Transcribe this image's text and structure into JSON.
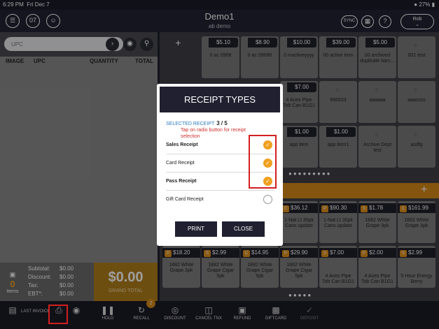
{
  "status": {
    "time": "6:29 PM",
    "date": "Fri Dec 7",
    "battery": "27%"
  },
  "header": {
    "title": "Demo1",
    "subtitle": "ab demo",
    "calendar": "07",
    "sync": "SYNC",
    "user": "Rob"
  },
  "left": {
    "search_placeholder": "UPC",
    "col_image": "IMAGE",
    "col_upc": "UPC",
    "col_qty": "QUANTITY",
    "col_total": "TOTAL",
    "items_count": "0",
    "items_label": "Items",
    "subtotal_label": "Subtotal:",
    "subtotal": "$0.00",
    "discount_label": "Discount:",
    "discount": "$0.00",
    "tax_label": "Tax:",
    "tax": "$0.00",
    "ebt_label": "EBT*:",
    "ebt": "$0.00",
    "grand_total": "$0.00",
    "grand_label": "GRAND TOTAL"
  },
  "grid_top": [
    {
      "price": "$5.10",
      "name": "0 ac 0908"
    },
    {
      "price": "$8.90",
      "name": "0 ac 09090"
    },
    {
      "price": "$10.00",
      "name": "0 inactiveyyyy"
    },
    {
      "price": "$39.00",
      "name": "00 active item"
    },
    {
      "price": "$5.00",
      "name": "00 archived duplicate barc..."
    },
    {
      "price": "",
      "name": "001 test"
    }
  ],
  "grid_mid": [
    {
      "price": "$7.00",
      "name": "4 Aces Pipe Tob Can B1G1"
    },
    {
      "price": "",
      "name": "996633"
    },
    {
      "price": "",
      "name": "aaaaaa"
    },
    {
      "price": "",
      "name": "aaassss"
    }
  ],
  "grid_row3": [
    {
      "price": "$1.00",
      "name": "app item"
    },
    {
      "price": "$1.00",
      "name": "app item1"
    },
    {
      "price": "",
      "name": "Archive Dept test"
    },
    {
      "price": "",
      "name": "asdfg"
    }
  ],
  "grid_low1": [
    {
      "tag": "C",
      "price": "$36.12",
      "name": "1-Nat Lt 30pk Cans update"
    },
    {
      "tag": "P",
      "price": "$90.30",
      "name": "1-Nat Lt 30pk Cans update"
    },
    {
      "tag": "S",
      "price": "$1.78",
      "name": "1882 White Grape 3pk"
    },
    {
      "tag": "C",
      "price": "$161.99",
      "name": "1882 White Grape 3pk"
    }
  ],
  "grid_low2": [
    {
      "tag": "P",
      "price": "$18.20",
      "name": "1882 White Grape 3pk"
    },
    {
      "tag": "S",
      "price": "$2.99",
      "name": "1882 White Grape Cigar 5pk"
    },
    {
      "tag": "C",
      "price": "$14.95",
      "name": "1882 White Grape Cigar 5pk"
    },
    {
      "tag": "P",
      "price": "$29.90",
      "name": "1882 White Grape Cigar 5pk"
    },
    {
      "tag": "S",
      "price": "$7.00",
      "name": "4 Aces Pipe Tob Can B1G1"
    },
    {
      "tag": "P",
      "price": "$2.00",
      "name": "4 Aces Pipe Tob Can B1G1"
    },
    {
      "tag": "S",
      "price": "$2.99",
      "name": "5 Hour Energy Berry"
    }
  ],
  "toolbar": {
    "last_invoice": "LAST INVOICE",
    "hold": "HOLD",
    "recall": "RECALL",
    "recall_badge": "2",
    "discount": "DISCOUNT",
    "cancel": "CANCEL TNX",
    "refund": "REFUND",
    "giftcard": "GIFTCARD",
    "deposit": "DEPOSIT"
  },
  "modal": {
    "title": "RECEIPT TYPES",
    "selected_label": "SELECTED RECEIPT",
    "selected_value": "3 / 5",
    "hint": "Tap on radio button for receipt selection",
    "options": [
      {
        "label": "Sales Receipt",
        "checked": true,
        "bold": true
      },
      {
        "label": "Card Receipt",
        "checked": true,
        "bold": false
      },
      {
        "label": "Pass Receipt",
        "checked": true,
        "bold": true
      },
      {
        "label": "Gift Card Receipt",
        "checked": false,
        "bold": false
      }
    ],
    "print": "PRINT",
    "close": "CLOSE"
  },
  "colors": {
    "accent": "#f0a020",
    "dark": "#202030",
    "highlight": "#d21f1f"
  }
}
